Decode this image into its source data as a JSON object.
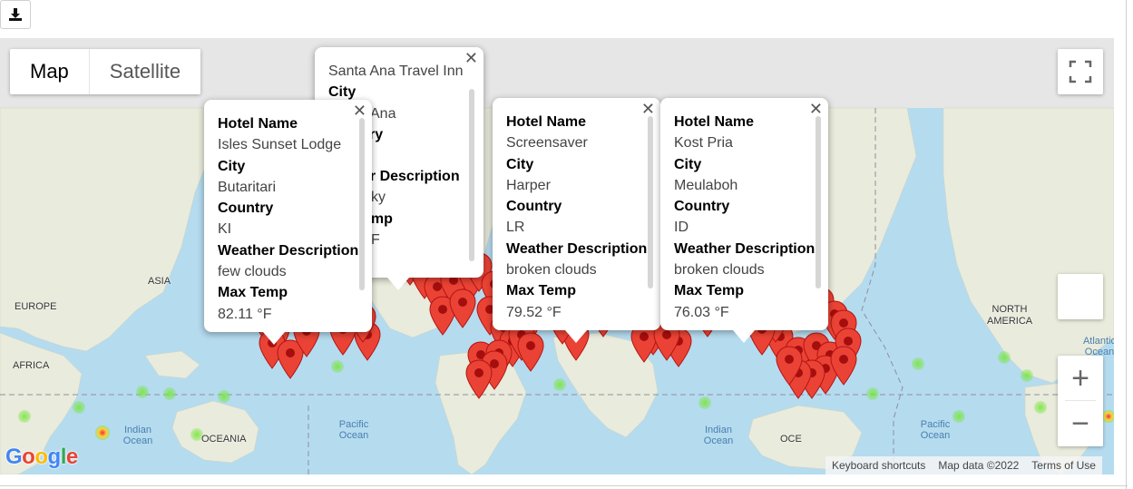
{
  "download_button": {
    "icon": "download-icon"
  },
  "map_type": {
    "map_label": "Map",
    "satellite_label": "Satellite",
    "selected": "Map"
  },
  "controls": {
    "fullscreen_icon": "fullscreen-icon",
    "pegman_icon": "pegman-icon",
    "zoom_in": "+",
    "zoom_out": "−"
  },
  "attribution": {
    "shortcuts": "Keyboard shortcuts",
    "map_data": "Map data ©2022",
    "terms": "Terms of Use"
  },
  "google_logo": "Google",
  "map_labels": {
    "asia": "ASIA",
    "europe": "EUROPE",
    "africa": "AFRICA",
    "oceania": "OCEANIA",
    "north_america": "NORTH AMERICA",
    "oceania_right": "OCE"
  },
  "ocean_labels": {
    "indian_1": "Indian Ocean",
    "indian_2": "Indian Ocean",
    "pacific_1": "Pacific Ocean",
    "pacific_2": "Pacific Ocean",
    "atlantic": "Atlantic Ocean"
  },
  "colors": {
    "marker": "#ea4335",
    "marker_dot": "#a50e0e",
    "heat": "#78e63c",
    "ocean": "#b5dbef",
    "land": "#e8ead9"
  },
  "info_windows": [
    {
      "hotel_label": "Hotel Name",
      "hotel": "Isles Sunset Lodge",
      "city_label": "City",
      "city": "Butaritari",
      "country_label": "Country",
      "country": "KI",
      "weather_label": "Weather Description",
      "weather": "few clouds",
      "temp_label": "Max Temp",
      "temp": "82.11 °F"
    },
    {
      "hotel": "Santa Ana Travel Inn",
      "city_label": "City",
      "city": "Ana",
      "country_label": "ry",
      "weather_label": "er Description",
      "weather": "ky",
      "temp_label": "emp",
      "temp": "F"
    },
    {
      "hotel_label": "Hotel Name",
      "hotel": "Screensaver",
      "city_label": "City",
      "city": "Harper",
      "country_label": "Country",
      "country": "LR",
      "weather_label": "Weather Description",
      "weather": "broken clouds",
      "temp_label": "Max Temp",
      "temp": "79.52 °F"
    },
    {
      "hotel_label": "Hotel Name",
      "hotel": "Kost Pria",
      "city_label": "City",
      "city": "Meulaboh",
      "country_label": "Country",
      "country": "ID",
      "weather_label": "Weather Description",
      "weather": "broken clouds",
      "temp_label": "Max Temp",
      "temp": "76.03 °F"
    }
  ]
}
